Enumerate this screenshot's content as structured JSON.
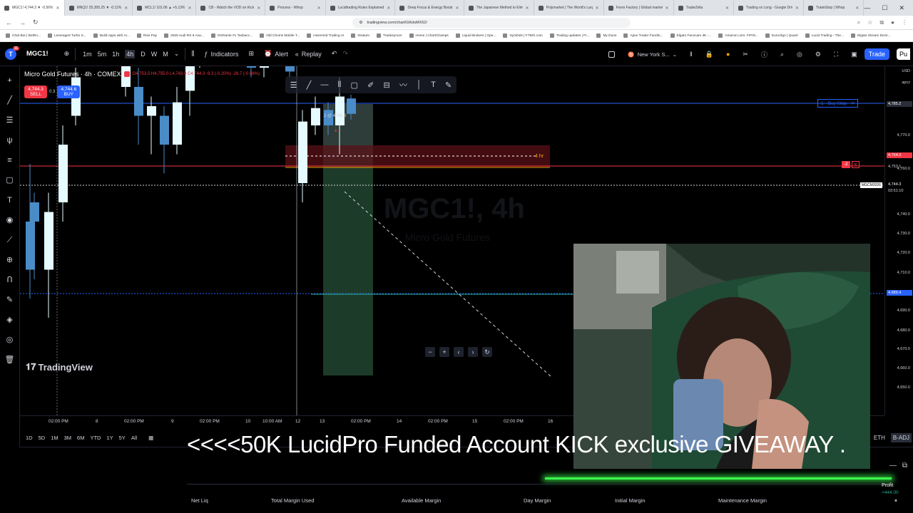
{
  "browser": {
    "tabs": [
      {
        "label": "MGC1! 4,744.3 ▼ -0.56% ",
        "active": true
      },
      {
        "label": "MNQ1! 25,305.25 ▼ -0.11% "
      },
      {
        "label": "MCL1! 101.06 ▲ +5.13% "
      },
      {
        "label": "CB - Watch the VOD on Kick"
      },
      {
        "label": "Process - Whop"
      },
      {
        "label": "Lucidtrading Rules Explained"
      },
      {
        "label": "Deep Focus & Energy Boost"
      },
      {
        "label": "The Japanese Method to Eliminate"
      },
      {
        "label": "Polymarket | The World's Largest Pr"
      },
      {
        "label": "Forex Factory | Global markets for"
      },
      {
        "label": "TradeZella"
      },
      {
        "label": "Trading vs Long - Google Drive"
      },
      {
        "label": "TradeStop | Whop"
      }
    ],
    "url": "tradingview.com/chart/GKdsMX62/",
    "bookmarks": [
      "Chat Bot | BotRo...",
      "Leveraged Turbo S...",
      "Build Apps with AI...",
      "Rise Pay",
      "2026 Audi RS 6 Ava...",
      "OGRants #1 Taxbacc...",
      "Old Chums Mobile T...",
      "Hivemind Trading AI",
      "Stratum",
      "Tradesyncer",
      "Home | ChartChamps",
      "Liquid Brokers | Ope...",
      "Symbols | FTMO.com",
      "Trading updates | FI...",
      "My Duos",
      "Apex Trader Fundin...",
      "Elgato Facecam 4K -...",
      "Amazon.com: FIFIN...",
      "EuroAlgo | Quant",
      "Lucid Trading - The...",
      "Elgato Stream Deck..."
    ]
  },
  "topbar": {
    "avatar_letter": "T",
    "avatar_badge": "11",
    "symbol": "MGC1!",
    "intervals": [
      "1m",
      "5m",
      "1h",
      "4h",
      "D",
      "W",
      "M"
    ],
    "indicators_label": "Indicators",
    "alert_label": "Alert",
    "replay_label": "Replay",
    "session_label": "New York S...",
    "trade_label": "Trade",
    "publish_label": "Pu"
  },
  "legend": {
    "title": "Micro Gold Futures · 4h · COMEX",
    "ohlc": "O4,753.5 H4,755.0 L4,743.0 C4,744.3 -9.3 (-0.20%) -26.7 (-0.56%)",
    "sell_price": "4,744.3",
    "sell_label": "SELL",
    "spread": "0.3",
    "buy_price": "4,744.6",
    "buy_label": "BUY"
  },
  "chart_overlay": {
    "order_label": "2 @ 4754.3",
    "tag_4hr": "4 hr",
    "buy_stop_label": "Buy Stop",
    "buy_stop_qty": "1",
    "position_qty": "-2",
    "mgcm_tag": "MGCM2026",
    "tradingview_wordmark": "TradingView",
    "watermark_symbol": "MGC1!, 4h",
    "watermark_name": "Micro Gold Futures"
  },
  "price_scale": {
    "currency": "USD",
    "mode": "apcz",
    "labels": [
      "4,770.0",
      "4,760.0",
      "4,740.0",
      "4,730.0",
      "4,720.0",
      "4,710.0",
      "4,700.0",
      "4,690.0",
      "4,680.0",
      "4,670.0",
      "4,660.0",
      "4,650.0"
    ],
    "tag_buystop": "4,785.2",
    "tag_order": "4,754.3",
    "tag_position": "4,753.1",
    "tag_last": "4,744.3",
    "tag_countdown": "03:51:10",
    "tag_low": "4,689.4"
  },
  "time_axis": [
    "02:00 PM",
    "8",
    "02:00 PM",
    "9",
    "02:00 PM",
    "10",
    "10:00 AM",
    "12",
    "13",
    "02:00 PM",
    "14",
    "02:00 PM",
    "15",
    "02:00 PM",
    "16"
  ],
  "ranges": [
    "1D",
    "5D",
    "1M",
    "3M",
    "6M",
    "YTD",
    "1Y",
    "5Y",
    "All"
  ],
  "ranges_right": {
    "eth": "ETH",
    "badj": "B-ADJ"
  },
  "bottom": {
    "columns": [
      "Net Liq",
      "Total Margin Used",
      "Available Margin",
      "Day Margin",
      "Initial Margin",
      "Maintenance Margin"
    ],
    "profit_label": "Profit",
    "profit_value": "+444.00",
    "row_fragment": "34"
  },
  "banner_text": "<<<<50K LucidPro Funded Account KICK exclusive GIVEAWAY .",
  "colors": {
    "bull_candle": "#e6fbff",
    "bear_candle": "#4a8cc7",
    "accent": "#2962ff",
    "sell": "#f23645",
    "glow": "#3cff4f"
  }
}
